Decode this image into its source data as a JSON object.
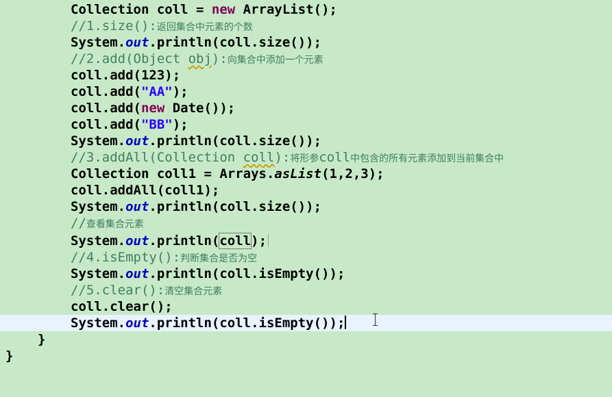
{
  "editor": {
    "lines": {
      "l1": {
        "a": "Collection coll = ",
        "kw": "new",
        "b": " ArrayList();"
      },
      "l2": {
        "code": "//1.size():",
        "zh": "返回集合中元素的个数"
      },
      "l3": {
        "a": "System.",
        "f": "out",
        "b": ".println(coll.size());"
      },
      "l4": {
        "code1": "//2.add(Object ",
        "sq": "obj",
        "code2": "):",
        "zh": "向集合中添加一个元素"
      },
      "l5": {
        "a": "coll.add(123);"
      },
      "l6": {
        "a": "coll.add(",
        "s": "\"AA\"",
        "b": ");"
      },
      "l7": {
        "a": "coll.add(",
        "kw": "new",
        "b": " Date());"
      },
      "l8": {
        "a": "coll.add(",
        "s": "\"BB\"",
        "b": ");"
      },
      "l9": {
        "a": "System.",
        "f": "out",
        "b": ".println(coll.size());"
      },
      "l10": {
        "code1": "//3.addAll(Collection ",
        "sq": "coll",
        "code2": "):",
        "zh1": "将形参",
        "code3": "coll",
        "zh2": "中包含的所有元素添加到当前集合中"
      },
      "l11": {
        "a": "Collection coll1 = Arrays.",
        "st": "asList",
        "b": "(1,2,3);"
      },
      "l12": {
        "a": "coll.addAll(coll1);"
      },
      "l13": {
        "a": "System.",
        "f": "out",
        "b": ".println(coll.size());"
      },
      "l14": {
        "code": "//",
        "zh": "查看集合元素"
      },
      "l15": {
        "a": "System.",
        "f": "out",
        "b": ".println(",
        "box": "coll",
        "c": ");"
      },
      "l16": {
        "code": "//4.isEmpty():",
        "zh": "判断集合是否为空"
      },
      "l17": {
        "a": "System.",
        "f": "out",
        "b": ".println(coll.isEmpty());"
      },
      "l18": {
        "code": "//5.clear():",
        "zh": "清空集合元素"
      },
      "l19": {
        "a": "coll.clear();"
      },
      "l20": {
        "a": "System.",
        "f": "out",
        "b": ".println(coll.isEmpty());"
      },
      "l21": {
        "a": "}"
      },
      "l22": {
        "a": "}"
      }
    }
  }
}
